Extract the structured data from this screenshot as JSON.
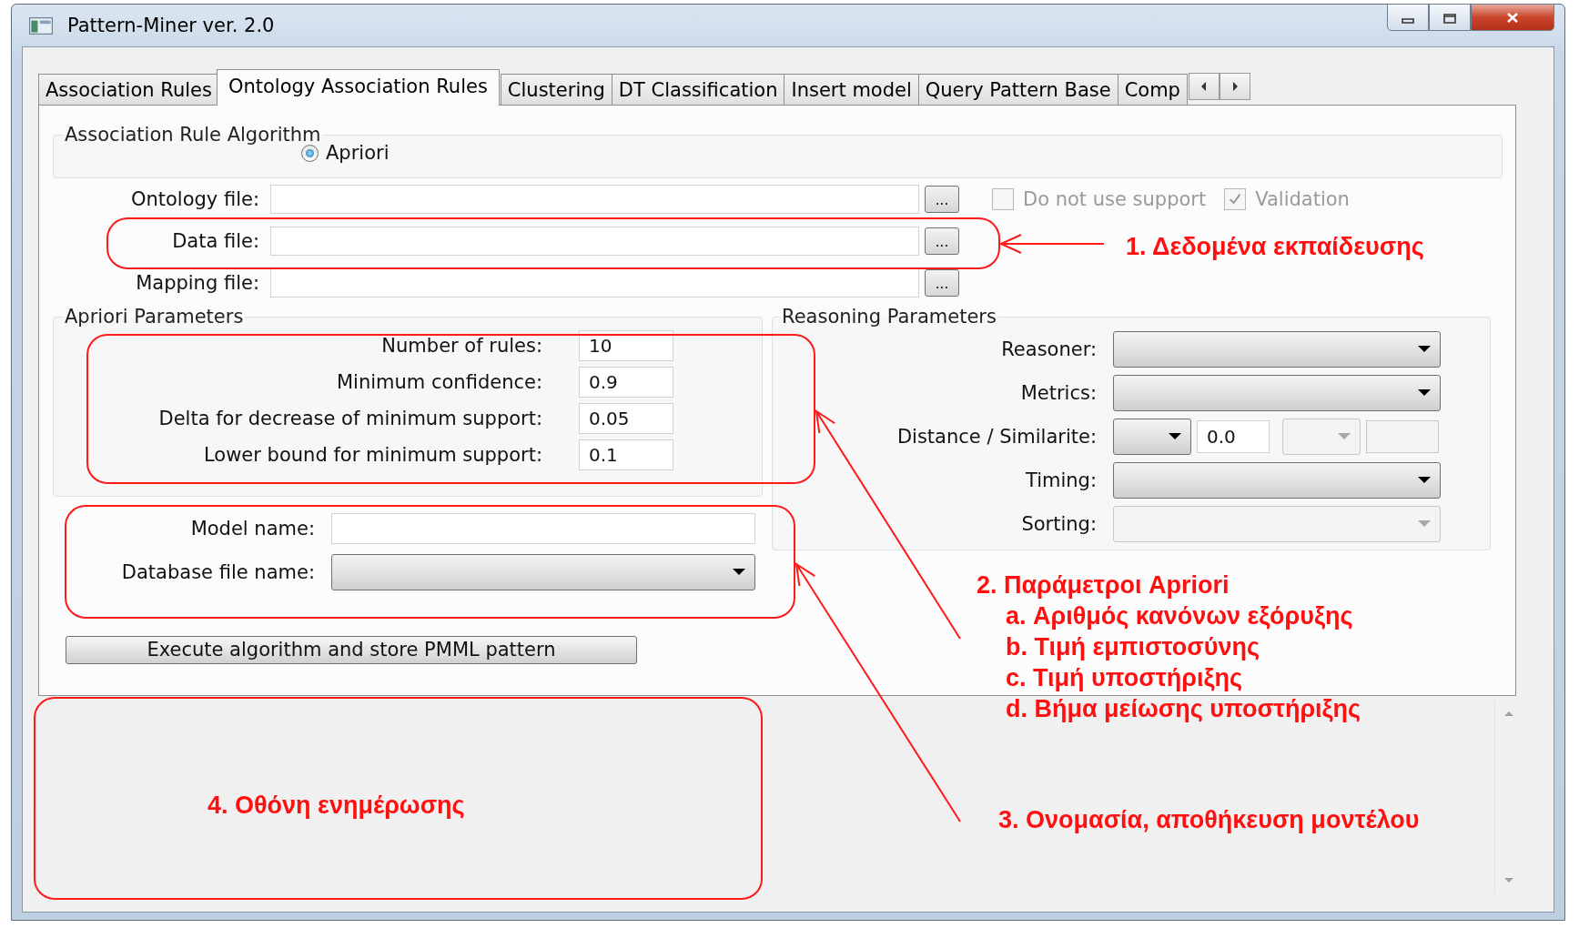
{
  "window": {
    "title": "Pattern-Miner ver. 2.0"
  },
  "tabs": [
    {
      "label": "Association Rules",
      "selected": false
    },
    {
      "label": "Ontology Association Rules",
      "selected": true
    },
    {
      "label": "Clustering",
      "selected": false
    },
    {
      "label": "DT Classification",
      "selected": false
    },
    {
      "label": "Insert model",
      "selected": false
    },
    {
      "label": "Query Pattern Base",
      "selected": false
    },
    {
      "label": "Comp",
      "selected": false
    }
  ],
  "algorithm_group": {
    "title": "Association Rule Algorithm",
    "options": [
      {
        "label": "Apriori",
        "selected": true
      }
    ]
  },
  "file_rows": [
    {
      "label": "Ontology file:",
      "button": "..."
    },
    {
      "label": "Data file:",
      "button": "..."
    },
    {
      "label": "Mapping file:",
      "button": "..."
    }
  ],
  "options": [
    {
      "label": "Do not use support",
      "checked": false,
      "disabled": true
    },
    {
      "label": "Validation",
      "checked": true,
      "disabled": true
    }
  ],
  "apriori_group": {
    "title": "Apriori Parameters",
    "fields": [
      {
        "label": "Number of rules:",
        "value": "10"
      },
      {
        "label": "Minimum confidence:",
        "value": "0.9"
      },
      {
        "label": "Delta for decrease of minimum support:",
        "value": "0.05"
      },
      {
        "label": "Lower bound for minimum support:",
        "value": "0.1"
      }
    ]
  },
  "reasoning_group": {
    "title": "Reasoning Parameters",
    "rows": [
      {
        "label": "Reasoner:",
        "controls": [
          {
            "kind": "combo",
            "disabled": false
          }
        ]
      },
      {
        "label": "Metrics:",
        "controls": [
          {
            "kind": "combo",
            "disabled": false
          }
        ]
      },
      {
        "label": "Distance / Similarite:",
        "controls": [
          {
            "kind": "small_combo",
            "disabled": false
          },
          {
            "kind": "text",
            "value": "0.0",
            "disabled": false
          },
          {
            "kind": "small_combo",
            "disabled": true
          },
          {
            "kind": "text",
            "disabled": true
          }
        ]
      },
      {
        "label": "Timing:",
        "controls": [
          {
            "kind": "combo",
            "disabled": false
          }
        ]
      },
      {
        "label": "Sorting:",
        "controls": [
          {
            "kind": "combo",
            "disabled": true
          }
        ]
      }
    ]
  },
  "model_fields": [
    {
      "label": "Model name:",
      "kind": "text"
    },
    {
      "label": "Database file name:",
      "kind": "combo"
    }
  ],
  "execute_button": "Execute algorithm and store PMML pattern",
  "annotations": [
    {
      "lines": [
        "1. Δεδομένα εκπαίδευσης"
      ]
    },
    {
      "lines": [
        "2. Παράμετροι Apriori",
        "a. Αριθμός κανόνων εξόρυξης",
        "b. Τιμή εμπιστοσύνης",
        "c. Τιμή υποστήριξης",
        "d. Βήμα μείωσης υποστήριξης"
      ]
    },
    {
      "lines": [
        "3. Ονομασία, αποθήκευση μοντέλου"
      ]
    },
    {
      "lines": [
        "4. Οθόνη ενημέρωσης"
      ]
    }
  ]
}
